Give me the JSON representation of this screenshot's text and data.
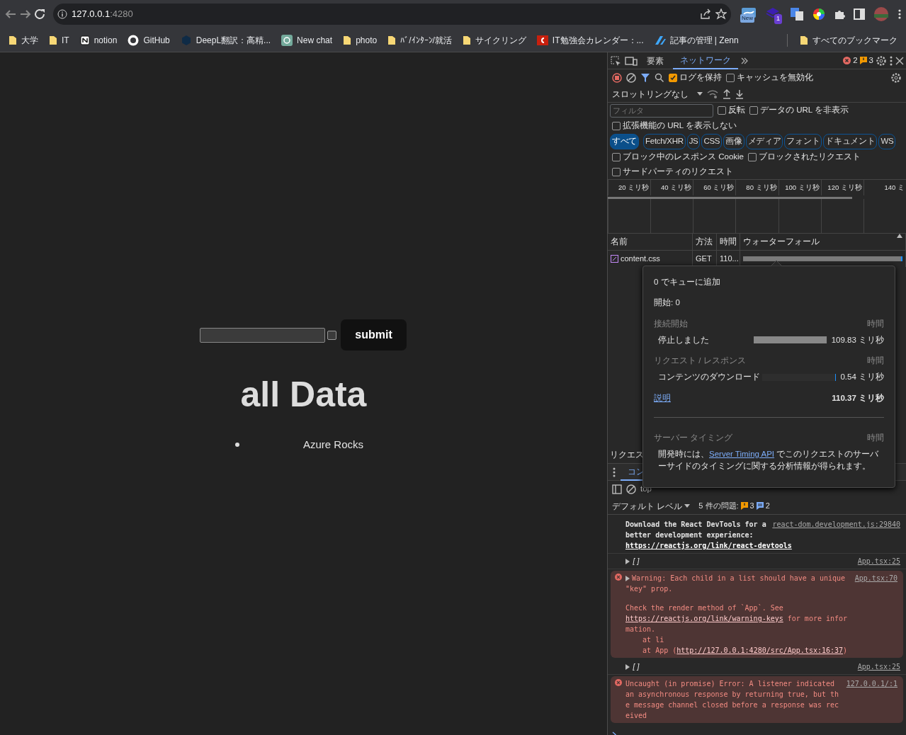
{
  "browser": {
    "url_host": "127.0.0.1",
    "url_port": ":4280",
    "extension_badges": [
      "New",
      "1"
    ],
    "bookmarks": [
      {
        "label": "大学",
        "kind": "folder"
      },
      {
        "label": "IT",
        "kind": "folder"
      },
      {
        "label": "notion",
        "kind": "notion"
      },
      {
        "label": "GitHub",
        "kind": "github"
      },
      {
        "label": "DeepL翻訳：高精...",
        "kind": "deepl"
      },
      {
        "label": "New chat",
        "kind": "chat"
      },
      {
        "label": "photo",
        "kind": "folder"
      },
      {
        "label": "ﾊﾞ/ｲﾝﾀｰﾝ/就活",
        "kind": "folder"
      },
      {
        "label": "サイクリング",
        "kind": "folder"
      },
      {
        "label": "IT勉強会カレンダー：...",
        "kind": "calendar"
      },
      {
        "label": "記事の管理 | Zenn",
        "kind": "zenn"
      }
    ],
    "all_bookmarks": "すべてのブックマーク"
  },
  "page": {
    "submit": "submit",
    "checked": false,
    "heading": "all Data",
    "items": [
      "Azure Rocks"
    ]
  },
  "devtools": {
    "tabs": [
      {
        "label": "要素",
        "selected": false
      },
      {
        "label": "ネットワーク",
        "selected": true
      }
    ],
    "errors": "2",
    "warnings": "3",
    "preserve_log": {
      "label": "ログを保持",
      "checked": true
    },
    "disable_cache": {
      "label": "キャッシュを無効化",
      "checked": false
    },
    "throttling": "スロットリングなし",
    "filter": {
      "placeholder": "フィルタ"
    },
    "filter_options": [
      {
        "label": "反転",
        "checked": false
      },
      {
        "label": "データの URL を非表示",
        "checked": false
      }
    ],
    "hide_extension": {
      "label": "拡張機能の URL を表示しない",
      "checked": false
    },
    "type_filters": [
      {
        "label": "すべて",
        "selected": true
      },
      {
        "label": "Fetch/XHR",
        "selected": false
      },
      {
        "label": "JS",
        "selected": false
      },
      {
        "label": "CSS",
        "selected": false
      },
      {
        "label": "画像",
        "selected": false
      },
      {
        "label": "メディア",
        "selected": false
      },
      {
        "label": "フォント",
        "selected": false
      },
      {
        "label": "ドキュメント",
        "selected": false
      },
      {
        "label": "WS",
        "selected": false
      }
    ],
    "more_options": [
      {
        "label": "ブロック中のレスポンス Cookie",
        "checked": false
      },
      {
        "label": "ブロックされたリクエスト",
        "checked": false
      }
    ],
    "third_party": {
      "label": "サードパーティのリクエスト",
      "checked": false
    },
    "timeline_ticks": [
      "20 ミリ秒",
      "40 ミリ秒",
      "60 ミリ秒",
      "80 ミリ秒",
      "100 ミリ秒",
      "120 ミリ秒",
      "140 ミ"
    ],
    "columns": [
      "名前",
      "方法",
      "時間",
      "ウォーターフォール"
    ],
    "requests": [
      {
        "name": "content.css",
        "method": "GET",
        "time": "110...",
        "level": 1
      }
    ],
    "popover": {
      "queued": "0 でキューに追加",
      "started": "開始: 0",
      "sections": [
        {
          "title": "接続開始",
          "time_header": "時間",
          "rows": [
            {
              "label": "停止しました",
              "value": "109.83 ミリ秒",
              "level": 0.99
            }
          ]
        },
        {
          "title": "リクエスト / レスポンス",
          "time_header": "時間",
          "rows": [
            {
              "label": "コンテンツのダウンロード",
              "value": "0.54 ミリ秒",
              "level": 0.01
            }
          ]
        }
      ],
      "explain_link": "説明",
      "total": "110.37 ミリ秒",
      "server_timing": {
        "title": "サーバー タイミング",
        "time_header": "時間",
        "parts": [
          {
            "text": "開発時には、",
            "link": false
          },
          {
            "text": "Server Timing API",
            "link": true
          },
          {
            "text": " でこのリクエストのサーバーサイドのタイミングに関する分析情報が得られます。",
            "link": false
          }
        ]
      }
    },
    "status_text": "リクエス",
    "drawer_tab": "コン",
    "context": "top",
    "log_level": "デフォルト レベル",
    "issues_label": "5 件の問題:",
    "issue_warnings": "3",
    "issue_infos": "2",
    "console": [
      {
        "kind": "log",
        "source": "react-dom.development.js:29840",
        "lines": [
          [
            {
              "text": "Download the React DevTools for a better development experience: ",
              "link": false
            },
            {
              "text": "https://reactjs.org/link/react-devtools",
              "link": true
            }
          ]
        ]
      },
      {
        "kind": "array",
        "source": "App.tsx:25",
        "lines": [
          [
            {
              "text": "[]",
              "link": false
            }
          ]
        ]
      },
      {
        "kind": "error",
        "expandable": true,
        "source": "App.tsx:70",
        "lines": [
          [
            {
              "text": "Warning: Each child in a list should have a unique \"key\" prop.",
              "link": false
            }
          ],
          [
            {
              "text": "Check the render method of `App`. See ",
              "link": false
            },
            {
              "text": "https://reactjs.org/link/warning-keys",
              "link": true
            },
            {
              "text": " for more information.",
              "link": false
            }
          ],
          [
            {
              "text": "    at li",
              "link": false
            }
          ],
          [
            {
              "text": "    at App (",
              "link": false
            },
            {
              "text": "http://127.0.0.1:4280/src/App.tsx:16:37",
              "link": true
            },
            {
              "text": ")",
              "link": false
            }
          ]
        ]
      },
      {
        "kind": "array",
        "source": "App.tsx:25",
        "lines": [
          [
            {
              "text": "[]",
              "link": false
            }
          ]
        ]
      },
      {
        "kind": "error",
        "expandable": false,
        "source": "127.0.0.1/:1",
        "lines": [
          [
            {
              "text": "Uncaught (in promise) Error: A listener indicated an asynchronous response by returning true, but the message channel closed before a response was received",
              "link": false
            }
          ]
        ]
      }
    ]
  }
}
